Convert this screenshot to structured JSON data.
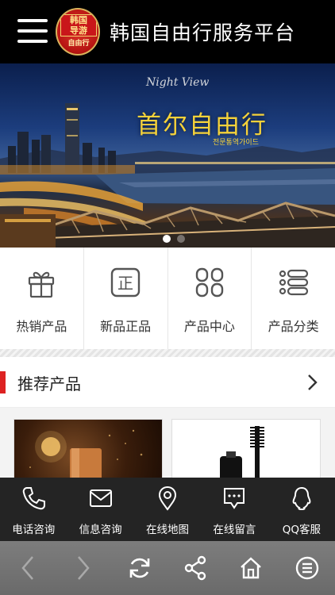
{
  "header": {
    "title": "韩国自由行服务平台",
    "logo_line1": "韩国",
    "logo_line2": "导游",
    "logo_line3": "自由行"
  },
  "banner": {
    "title": "首尔自由行",
    "subtitle": "전문통역가이드",
    "brand": "Night View",
    "slide_count": 2,
    "active_slide": 1
  },
  "quick_nav": [
    {
      "label": "热销产品",
      "icon": "gift-icon"
    },
    {
      "label": "新品正品",
      "icon": "genuine-icon"
    },
    {
      "label": "产品中心",
      "icon": "grid-icon"
    },
    {
      "label": "产品分类",
      "icon": "list-icon"
    }
  ],
  "section": {
    "title": "推荐产品"
  },
  "contact_bar": [
    {
      "label": "电话咨询",
      "icon": "phone-icon"
    },
    {
      "label": "信息咨询",
      "icon": "mail-icon"
    },
    {
      "label": "在线地图",
      "icon": "location-pin-icon"
    },
    {
      "label": "在线留言",
      "icon": "message-icon"
    },
    {
      "label": "QQ客服",
      "icon": "qq-icon"
    }
  ],
  "toolbar": [
    {
      "icon": "back-arrow-icon"
    },
    {
      "icon": "forward-arrow-icon"
    },
    {
      "icon": "refresh-icon"
    },
    {
      "icon": "share-icon"
    },
    {
      "icon": "home-icon"
    },
    {
      "icon": "menu-circle-icon"
    }
  ],
  "colors": {
    "header_bg": "#000000",
    "accent": "#dd2222",
    "contact_bg": "#242424",
    "toolbar_bg": "#737373",
    "banner_title": "#f5d23a"
  }
}
